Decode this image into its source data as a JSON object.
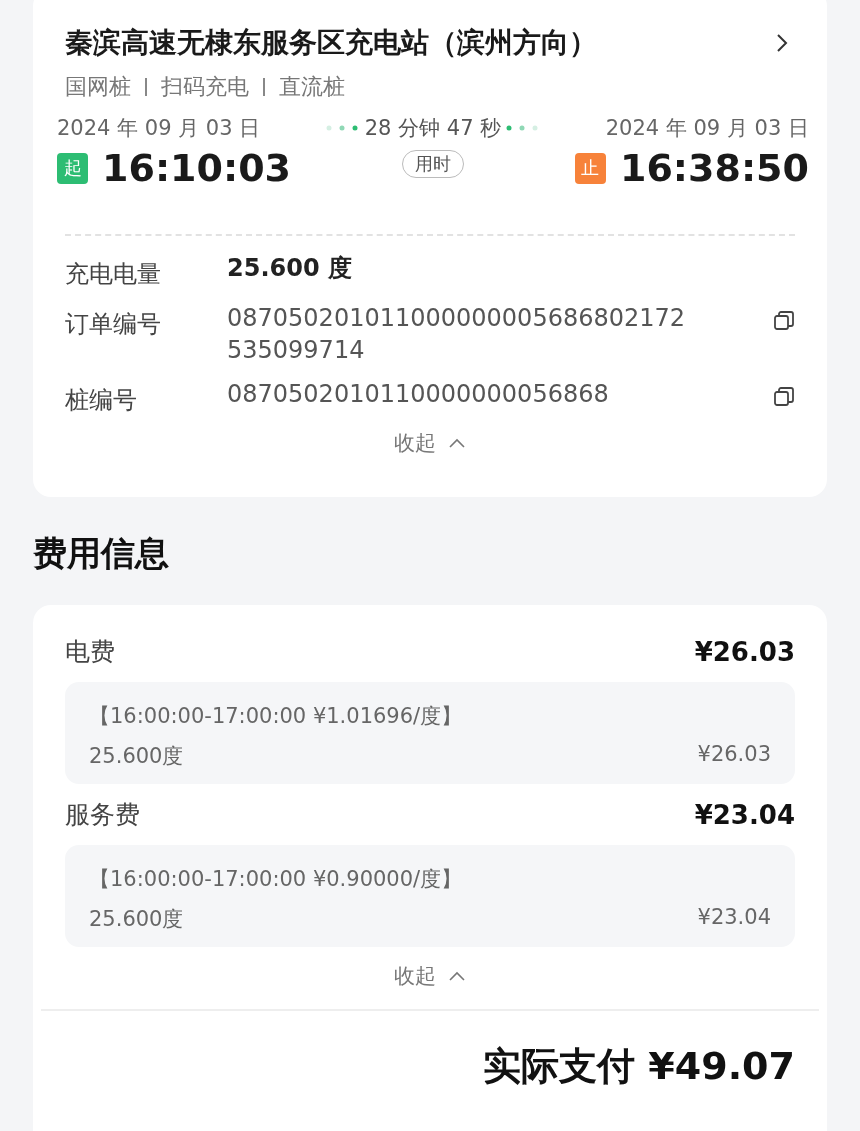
{
  "station": {
    "title": "秦滨高速无棣东服务区充电站（滨州方向）",
    "tags": [
      "国网桩",
      "扫码充电",
      "直流桩"
    ]
  },
  "session": {
    "start": {
      "date": "2024 年 09 月 03 日",
      "badge": "起",
      "time": "16:10:03",
      "color": "#2dbd73"
    },
    "duration": "28 分钟 47 秒",
    "duration_label": "用时",
    "end": {
      "date": "2024 年 09 月 03 日",
      "badge": "止",
      "time": "16:38:50",
      "color": "#f7823a"
    }
  },
  "details": [
    {
      "label": "充电电量",
      "value": "25.600 度",
      "kind": "bold"
    },
    {
      "label": "订单编号",
      "value": "087050201011000000005686802172535099714",
      "kind": "copy"
    },
    {
      "label": "桩编号",
      "value": "0870502010110000000056868",
      "kind": "copy"
    }
  ],
  "details_toggle": "收起",
  "fees_title": "费用信息",
  "fees": [
    {
      "name": "电费",
      "amount": "¥26.03",
      "period": "【16:00:00-17:00:00  ¥1.01696/度】",
      "energy": "25.600度",
      "subtotal": "¥26.03"
    },
    {
      "name": "服务费",
      "amount": "¥23.04",
      "period": "【16:00:00-17:00:00  ¥0.90000/度】",
      "energy": "25.600度",
      "subtotal": "¥23.04"
    }
  ],
  "fees_toggle": "收起",
  "total": "实际支付 ¥49.07"
}
